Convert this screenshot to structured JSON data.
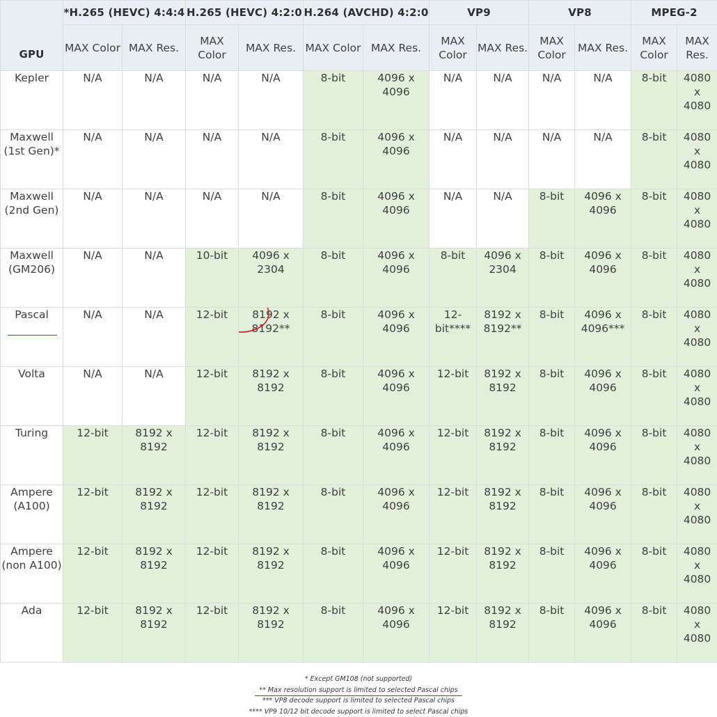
{
  "table": {
    "gpu_header": "GPU",
    "codecs": [
      "*H.265 (HEVC) 4:4:4",
      "H.265 (HEVC) 4:2:0",
      "H.264 (AVCHD) 4:2:0",
      "VP9",
      "VP8",
      "MPEG-2"
    ],
    "sub_headers": [
      "MAX Color",
      "MAX Res."
    ],
    "rows": [
      {
        "gpu": "Kepler",
        "cells": [
          {
            "v": "N/A",
            "s": false
          },
          {
            "v": "N/A",
            "s": false
          },
          {
            "v": "N/A",
            "s": false
          },
          {
            "v": "N/A",
            "s": false
          },
          {
            "v": "8-bit",
            "s": true
          },
          {
            "v": "4096 x 4096",
            "s": true
          },
          {
            "v": "N/A",
            "s": false
          },
          {
            "v": "N/A",
            "s": false
          },
          {
            "v": "N/A",
            "s": false
          },
          {
            "v": "N/A",
            "s": false
          },
          {
            "v": "8-bit",
            "s": true
          },
          {
            "v": "4080 x 4080",
            "s": true
          }
        ]
      },
      {
        "gpu": "Maxwell (1st Gen)*",
        "cells": [
          {
            "v": "N/A",
            "s": false
          },
          {
            "v": "N/A",
            "s": false
          },
          {
            "v": "N/A",
            "s": false
          },
          {
            "v": "N/A",
            "s": false
          },
          {
            "v": "8-bit",
            "s": true
          },
          {
            "v": "4096 x 4096",
            "s": true
          },
          {
            "v": "N/A",
            "s": false
          },
          {
            "v": "N/A",
            "s": false
          },
          {
            "v": "N/A",
            "s": false
          },
          {
            "v": "N/A",
            "s": false
          },
          {
            "v": "8-bit",
            "s": true
          },
          {
            "v": "4080 x 4080",
            "s": true
          }
        ]
      },
      {
        "gpu": "Maxwell (2nd Gen)",
        "cells": [
          {
            "v": "N/A",
            "s": false
          },
          {
            "v": "N/A",
            "s": false
          },
          {
            "v": "N/A",
            "s": false
          },
          {
            "v": "N/A",
            "s": false
          },
          {
            "v": "8-bit",
            "s": true
          },
          {
            "v": "4096 x 4096",
            "s": true
          },
          {
            "v": "N/A",
            "s": false
          },
          {
            "v": "N/A",
            "s": false
          },
          {
            "v": "8-bit",
            "s": true
          },
          {
            "v": "4096 x 4096",
            "s": true
          },
          {
            "v": "8-bit",
            "s": true
          },
          {
            "v": "4080 x 4080",
            "s": true
          }
        ]
      },
      {
        "gpu": "Maxwell (GM206)",
        "cells": [
          {
            "v": "N/A",
            "s": false
          },
          {
            "v": "N/A",
            "s": false
          },
          {
            "v": "10-bit",
            "s": true
          },
          {
            "v": "4096 x 2304",
            "s": true
          },
          {
            "v": "8-bit",
            "s": true
          },
          {
            "v": "4096 x 4096",
            "s": true
          },
          {
            "v": "8-bit",
            "s": true
          },
          {
            "v": "4096 x 2304",
            "s": true
          },
          {
            "v": "8-bit",
            "s": true
          },
          {
            "v": "4096 x 4096",
            "s": true
          },
          {
            "v": "8-bit",
            "s": true
          },
          {
            "v": "4080 x 4080",
            "s": true
          }
        ]
      },
      {
        "gpu": "Pascal",
        "cells": [
          {
            "v": "N/A",
            "s": false
          },
          {
            "v": "N/A",
            "s": false
          },
          {
            "v": "12-bit",
            "s": true
          },
          {
            "v": "8192 x 8192**",
            "s": true
          },
          {
            "v": "8-bit",
            "s": true
          },
          {
            "v": "4096 x 4096",
            "s": true
          },
          {
            "v": "12-bit****",
            "s": true
          },
          {
            "v": "8192 x 8192**",
            "s": true
          },
          {
            "v": "8-bit",
            "s": true
          },
          {
            "v": "4096 x 4096***",
            "s": true
          },
          {
            "v": "8-bit",
            "s": true
          },
          {
            "v": "4080 x 4080",
            "s": true
          }
        ]
      },
      {
        "gpu": "Volta",
        "cells": [
          {
            "v": "N/A",
            "s": false
          },
          {
            "v": "N/A",
            "s": false
          },
          {
            "v": "12-bit",
            "s": true
          },
          {
            "v": "8192 x 8192",
            "s": true
          },
          {
            "v": "8-bit",
            "s": true
          },
          {
            "v": "4096 x 4096",
            "s": true
          },
          {
            "v": "12-bit",
            "s": true
          },
          {
            "v": "8192 x 8192",
            "s": true
          },
          {
            "v": "8-bit",
            "s": true
          },
          {
            "v": "4096 x 4096",
            "s": true
          },
          {
            "v": "8-bit",
            "s": true
          },
          {
            "v": "4080 x 4080",
            "s": true
          }
        ]
      },
      {
        "gpu": "Turing",
        "cells": [
          {
            "v": "12-bit",
            "s": true
          },
          {
            "v": "8192 x 8192",
            "s": true
          },
          {
            "v": "12-bit",
            "s": true
          },
          {
            "v": "8192 x 8192",
            "s": true
          },
          {
            "v": "8-bit",
            "s": true
          },
          {
            "v": "4096 x 4096",
            "s": true
          },
          {
            "v": "12-bit",
            "s": true
          },
          {
            "v": "8192 x 8192",
            "s": true
          },
          {
            "v": "8-bit",
            "s": true
          },
          {
            "v": "4096 x 4096",
            "s": true
          },
          {
            "v": "8-bit",
            "s": true
          },
          {
            "v": "4080 x 4080",
            "s": true
          }
        ]
      },
      {
        "gpu": "Ampere (A100)",
        "cells": [
          {
            "v": "12-bit",
            "s": true
          },
          {
            "v": "8192 x 8192",
            "s": true
          },
          {
            "v": "12-bit",
            "s": true
          },
          {
            "v": "8192 x 8192",
            "s": true
          },
          {
            "v": "8-bit",
            "s": true
          },
          {
            "v": "4096 x 4096",
            "s": true
          },
          {
            "v": "12-bit",
            "s": true
          },
          {
            "v": "8192 x 8192",
            "s": true
          },
          {
            "v": "8-bit",
            "s": true
          },
          {
            "v": "4096 x 4096",
            "s": true
          },
          {
            "v": "8-bit",
            "s": true
          },
          {
            "v": "4080 x 4080",
            "s": true
          }
        ]
      },
      {
        "gpu": "Ampere (non A100)",
        "cells": [
          {
            "v": "12-bit",
            "s": true
          },
          {
            "v": "8192 x 8192",
            "s": true
          },
          {
            "v": "12-bit",
            "s": true
          },
          {
            "v": "8192 x 8192",
            "s": true
          },
          {
            "v": "8-bit",
            "s": true
          },
          {
            "v": "4096 x 4096",
            "s": true
          },
          {
            "v": "12-bit",
            "s": true
          },
          {
            "v": "8192 x 8192",
            "s": true
          },
          {
            "v": "8-bit",
            "s": true
          },
          {
            "v": "4096 x 4096",
            "s": true
          },
          {
            "v": "8-bit",
            "s": true
          },
          {
            "v": "4080 x 4080",
            "s": true
          }
        ]
      },
      {
        "gpu": "Ada",
        "cells": [
          {
            "v": "12-bit",
            "s": true
          },
          {
            "v": "8192 x 8192",
            "s": true
          },
          {
            "v": "12-bit",
            "s": true
          },
          {
            "v": "8192 x 8192",
            "s": true
          },
          {
            "v": "8-bit",
            "s": true
          },
          {
            "v": "4096 x 4096",
            "s": true
          },
          {
            "v": "12-bit",
            "s": true
          },
          {
            "v": "8192 x 8192",
            "s": true
          },
          {
            "v": "8-bit",
            "s": true
          },
          {
            "v": "4096 x 4096",
            "s": true
          },
          {
            "v": "8-bit",
            "s": true
          },
          {
            "v": "4080 x 4080",
            "s": true
          }
        ]
      }
    ]
  },
  "annotations": {
    "underlined_gpu": "Pascal",
    "circled_cell_value": "8192 x 8192**",
    "mark_color": "#d11a1a"
  },
  "colors": {
    "header_bg": "#e8eef2",
    "supported_bg": "#e0f0da",
    "unsupported_bg": "#ffffff",
    "border": "#dcdcdc"
  },
  "footnotes": [
    "* Except GM108 (not supported)",
    "** Max resolution support is limited to selected Pascal chips",
    "*** VP8 decode support is limited to selected Pascal chips",
    "**** VP9 10/12 bit decode support is limited to select Pascal chips"
  ]
}
